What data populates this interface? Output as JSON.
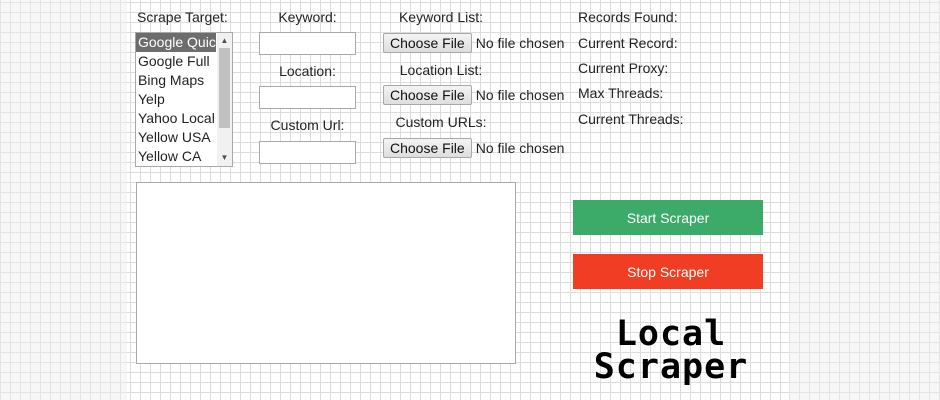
{
  "form": {
    "scrape_target_label": "Scrape Target:",
    "keyword_label": "Keyword:",
    "location_label": "Location:",
    "custom_url_label": "Custom Url:",
    "keyword_list_label": "Keyword List:",
    "location_list_label": "Location List:",
    "custom_urls_label": "Custom URLs:",
    "choose_file_label": "Choose File",
    "no_file_text": "No file chosen",
    "keyword_value": "",
    "location_value": "",
    "custom_url_value": ""
  },
  "targets": {
    "selected": "Google Quick",
    "items": [
      "Google Quick",
      "Google Full",
      "Bing Maps",
      "Yelp",
      "Yahoo Local",
      "Yellow USA",
      "Yellow CA"
    ]
  },
  "stats": {
    "records_found": "Records Found:",
    "current_record": "Current Record:",
    "current_proxy": "Current Proxy:",
    "max_threads": "Max Threads:",
    "current_threads": "Current Threads:"
  },
  "output": {
    "value": ""
  },
  "buttons": {
    "start": "Start Scraper",
    "stop": "Stop Scraper",
    "start_color": "#3cab69",
    "stop_color": "#f13d23"
  },
  "logo": {
    "line1": "Local",
    "line2": "Scraper"
  }
}
